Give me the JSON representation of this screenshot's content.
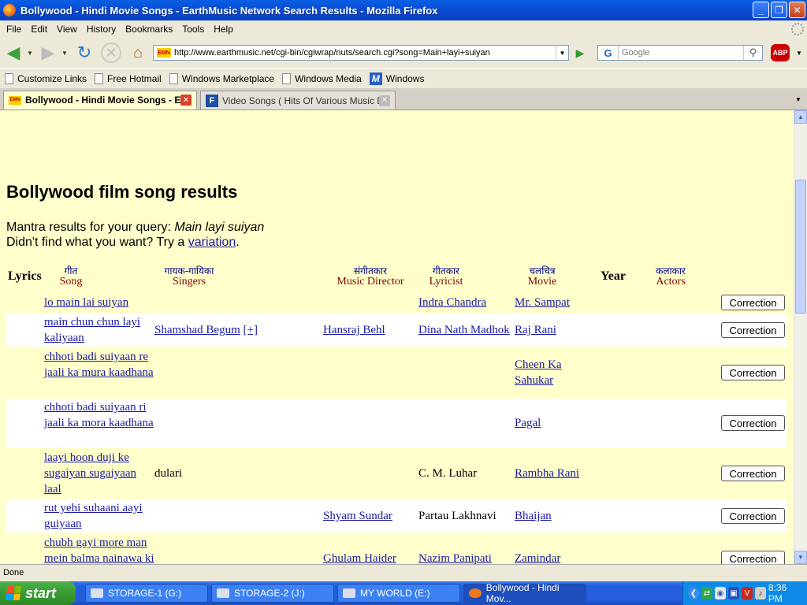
{
  "window": {
    "title": "Bollywood - Hindi Movie Songs - EarthMusic Network Search Results - Mozilla Firefox",
    "min_label": "_",
    "max_label": "❐",
    "close_label": "✕"
  },
  "menu": [
    "File",
    "Edit",
    "View",
    "History",
    "Bookmarks",
    "Tools",
    "Help"
  ],
  "nav": {
    "url": "http://www.earthmusic.net/cgi-bin/cgiwrap/nuts/search.cgi?song=Main+layi+suiyan",
    "site_icon_text": "EMN",
    "search_placeholder": "Google",
    "search_engine_glyph": "G",
    "abp_label": "ABP"
  },
  "bookmarks": [
    "Customize Links",
    "Free Hotmail",
    "Windows Marketplace",
    "Windows Media",
    "Windows"
  ],
  "tabs": [
    {
      "label": "Bollywood - Hindi Movie Songs - E...",
      "active": true
    },
    {
      "label": "Video Songs ( Hits Of Various Music Dir...",
      "active": false
    }
  ],
  "page": {
    "title": "Bollywood film song results",
    "query_prefix": "Mantra results for your query: ",
    "query": "Main layi suiyan",
    "variation_prefix": "Didn't find what you want? Try a ",
    "variation_link": "variation",
    "variation_suffix": "."
  },
  "table": {
    "headers": {
      "lyrics": "Lyrics",
      "song_hi": "गीत",
      "song": "Song",
      "singers_hi": "गायक-गायिका",
      "singers": "Singers",
      "md_hi": "संगीतकार",
      "md": "Music Director",
      "lyricist_hi": "गीतकार",
      "lyricist": "Lyricist",
      "movie_hi": "चलचित्र",
      "movie": "Movie",
      "year": "Year",
      "actors_hi": "कलाकार",
      "actors": "Actors"
    },
    "correction_label": "Correction",
    "rows": [
      {
        "song": "lo main lai suiyan",
        "singer": "",
        "singer_more": "",
        "md": "",
        "lyricist": "Indra Chandra",
        "movie": "Mr. Sampat"
      },
      {
        "song": "main chun chun layi kaliyaan",
        "singer": "Shamshad Begum",
        "singer_more": "[+]",
        "md": "Hansraj Behl",
        "lyricist": "Dina Nath Madhok",
        "movie": "Raj Rani"
      },
      {
        "song": "chhoti badi suiyaan re jaali ka mura kaadhana",
        "singer": "",
        "singer_more": "",
        "md": "",
        "lyricist": "",
        "movie": "Cheen Ka Sahukar"
      },
      {
        "song": "chhoti badi suiyaan ri jaali ka mora kaadhana",
        "singer": "",
        "singer_more": "",
        "md": "",
        "lyricist": "",
        "movie": "Pagal"
      },
      {
        "song": "laayi hoon duji ke sugaiyan sugaiyaan laal",
        "singer": "dulari",
        "singer_more": "",
        "md": "",
        "lyricist": "C. M. Luhar",
        "movie": "Rambha Rani"
      },
      {
        "song": "rut yehi suhaani aayi guiyaan",
        "singer": "",
        "singer_more": "",
        "md": "Shyam Sundar",
        "lyricist": "Partau Lakhnavi",
        "movie": "Bhaijan"
      },
      {
        "song": "chubh gayi more man mein balma nainawa ki",
        "singer": "",
        "singer_more": "",
        "md": "Ghulam Haider",
        "lyricist": "Nazim Panipati",
        "movie": "Zamindar"
      }
    ]
  },
  "status": "Done",
  "taskbar": {
    "start": "start",
    "tasks": [
      "STORAGE-1 (G:)",
      "STORAGE-2 (J:)",
      "MY WORLD (E:)",
      "Bollywood - Hindi Mov..."
    ],
    "clock": "8:36 PM"
  },
  "colors": {
    "page_bg": "#ffffcc",
    "link": "#1a1aa6",
    "header_en": "#800000",
    "header_hi": "#00008b"
  }
}
